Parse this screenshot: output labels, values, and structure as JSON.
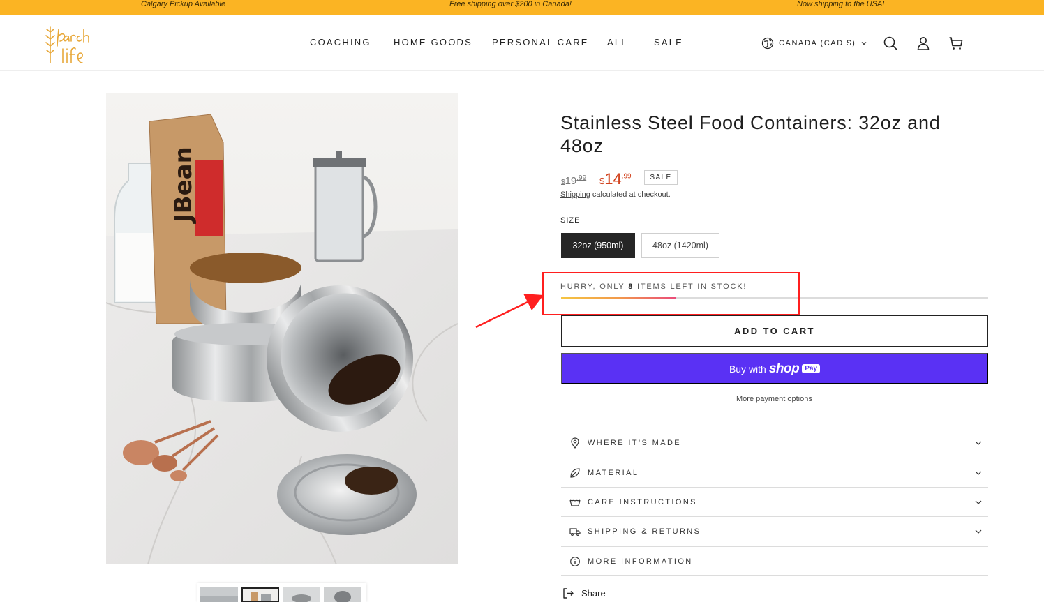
{
  "announcement": {
    "left": "Calgary Pickup Available",
    "center": "Free shipping over $200 in Canada!",
    "right": "Now shipping to the USA!"
  },
  "header": {
    "logo_text": "larch life",
    "nav": [
      "COACHING",
      "HOME GOODS",
      "PERSONAL CARE",
      "ALL",
      "SALE"
    ],
    "currency_label": "CANADA (CAD $)",
    "icons": [
      "globe-icon",
      "search-icon",
      "account-icon",
      "cart-icon"
    ]
  },
  "product": {
    "title": "Stainless Steel Food Containers: 32oz and 48oz",
    "old_price_currency": "$",
    "old_price_main": "19",
    "old_price_cents": ".99",
    "new_price_currency": "$",
    "new_price_main": "14",
    "new_price_cents": ".99",
    "sale_badge": "SALE",
    "shipping_link": "Shipping",
    "shipping_text": " calculated at checkout.",
    "size_label": "SIZE",
    "sizes": [
      "32oz (950ml)",
      "48oz (1420ml)"
    ],
    "selected_size": "32oz (950ml)",
    "stock_prefix": "HURRY, ONLY ",
    "stock_count": "8",
    "stock_suffix": " ITEMS LEFT IN STOCK!",
    "stock_level_fraction": 0.27,
    "add_to_cart": "ADD TO CART",
    "buy_with": "Buy with",
    "shop_word": "shop",
    "pay_word": "Pay",
    "more_payment": "More payment options",
    "accordions": [
      "WHERE IT'S MADE",
      "MATERIAL",
      "CARE INSTRUCTIONS",
      "SHIPPING & RETURNS",
      "MORE INFORMATION"
    ],
    "share": "Share"
  },
  "colors": {
    "announcement_bg": "#fbb423",
    "sale_price": "#d1401b",
    "shop_pay": "#5a31f4",
    "highlight": "#ff1f1f"
  }
}
